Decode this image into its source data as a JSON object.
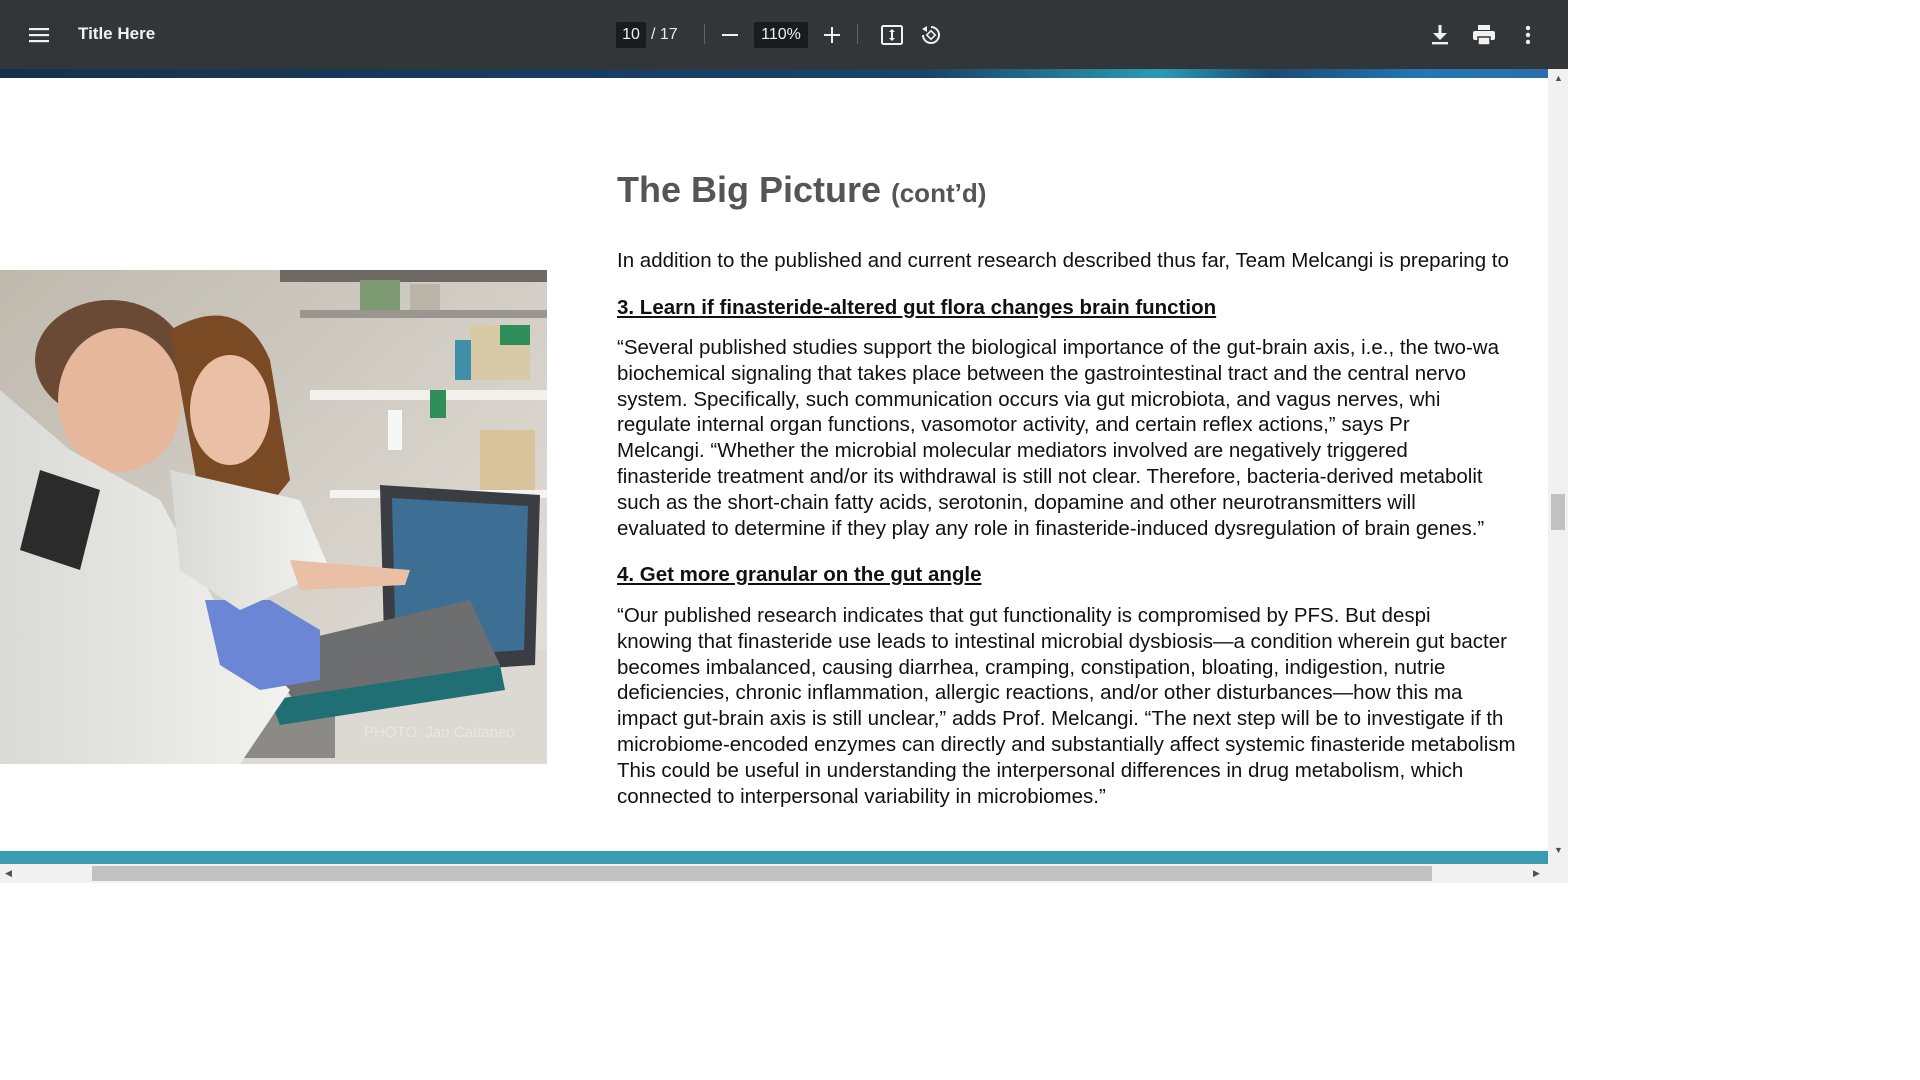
{
  "toolbar": {
    "title": "Title Here",
    "page_current": "10",
    "page_separator": "/",
    "page_total": "17",
    "zoom": "110%",
    "menu_icon": "hamburger-menu-icon",
    "zoom_out_icon": "minus-icon",
    "zoom_in_icon": "plus-icon",
    "fit_icon": "fit-to-page-icon",
    "rotate_icon": "rotate-counterclockwise-icon",
    "download_icon": "download-icon",
    "print_icon": "print-icon",
    "more_icon": "more-vertical-icon",
    "background_color": "#323639"
  },
  "document": {
    "heading": "The Big Picture",
    "heading_suffix": "(cont’d)",
    "intro": "In addition to the published and current research described thus far, Team Melcangi is preparing to",
    "sections": [
      {
        "title": "3. Learn if finasteride-altered gut flora changes brain function",
        "lines": [
          "“Several published studies support the biological importance of the gut-brain axis, i.e., the two-wa",
          "biochemical signaling that takes place between the gastrointestinal tract and the central nervo",
          "system. Specifically, such communication occurs via gut microbiota, and vagus nerves, whi",
          "regulate internal organ functions, vasomotor activity, and certain reflex actions,” says Pr",
          "Melcangi. “Whether the microbial molecular mediators involved are negatively triggered",
          "finasteride treatment and/or its withdrawal is still not clear. Therefore, bacteria-derived metabolit",
          "such as the short-chain fatty acids, serotonin, dopamine and other neurotransmitters will",
          "evaluated to determine if they play any role in finasteride-induced dysregulation of brain genes.”"
        ]
      },
      {
        "title": "4. Get more granular on the gut angle",
        "lines": [
          "“Our published research indicates that gut functionality is compromised by PFS. But despi",
          "knowing that finasteride use leads to intestinal microbial dysbiosis—a condition wherein gut bacter",
          "becomes imbalanced, causing diarrhea, cramping, constipation, bloating, indigestion, nutrie",
          "deficiencies, chronic inflammation, allergic reactions, and/or other disturbances—how this ma",
          "impact gut-brain axis is still unclear,” adds Prof. Melcangi. “The next step will be to investigate if th",
          "microbiome-encoded enzymes can directly and substantially affect systemic finasteride metabolism",
          "This could be useful in understanding the interpersonal differences in drug metabolism, which",
          "connected to interpersonal variability in microbiomes.”"
        ]
      }
    ],
    "photo_credit": "PHOTO: Jan Cattaneo"
  },
  "scrollbars": {
    "up_arrow": "▲",
    "down_arrow": "▼",
    "left_arrow": "◀",
    "right_arrow": "▶"
  }
}
